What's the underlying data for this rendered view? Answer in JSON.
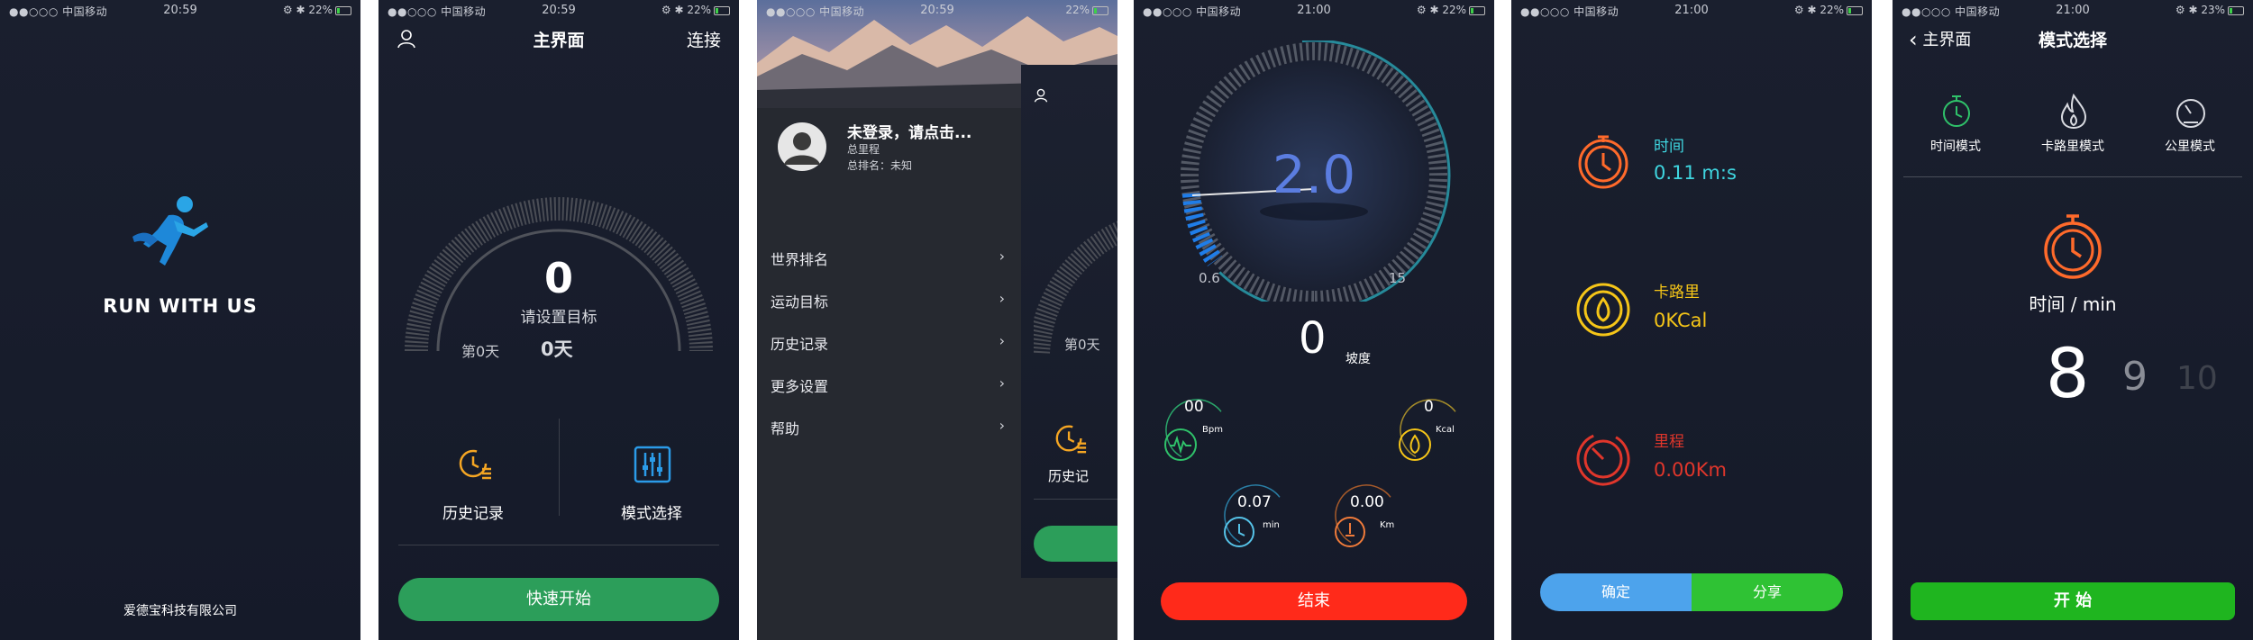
{
  "statusbar": {
    "carrier": "●●○○○ 中国移动",
    "s1_time": "20:59",
    "s1_right": "⚙ ✱ 22%",
    "s2_time": "20:59",
    "s2_right": "⚙ ✱ 22%",
    "s3_time": "20:59",
    "s3_right": "22%",
    "s4_time": "21:00",
    "s4_right": "⚙ ✱ 22%",
    "s5_time": "21:00",
    "s5_right": "⚙ ✱ 22%",
    "s6_time": "21:00",
    "s6_right": "⚙ ✱ 23%"
  },
  "splash": {
    "app_name": "RUN WITH US",
    "company": "爱德宝科技有限公司"
  },
  "home": {
    "title": "主界面",
    "connect": "连接",
    "goal_value": "0",
    "goal_hint": "请设置目标",
    "day_label": "第0天",
    "day_value": "0天",
    "history": "历史记录",
    "mode": "模式选择",
    "quick_start": "快速开始"
  },
  "drawer": {
    "login": "未登录，请点击...",
    "total_mileage": "总里程",
    "total_rank": "总排名：未知",
    "items": [
      "世界排名",
      "运动目标",
      "历史记录",
      "更多设置",
      "帮助"
    ],
    "peek_day": "第0天",
    "peek_history": "历史记"
  },
  "dashboard": {
    "speed": "2.0",
    "min_label": "0.6",
    "max_label": "15",
    "incline": "0",
    "incline_label": "坡度",
    "bpm_value": "00",
    "bpm_unit": "Bpm",
    "kcal_value": "0",
    "kcal_unit": "Kcal",
    "time_value": "0.07",
    "time_unit": "min",
    "km_value": "0.00",
    "km_unit": "Km",
    "end": "结束"
  },
  "summary": {
    "time_label": "时间",
    "time_value": "0.11 m:s",
    "cal_label": "卡路里",
    "cal_value": "0KCal",
    "dist_label": "里程",
    "dist_value": "0.00Km",
    "confirm": "确定",
    "share": "分享",
    "colors": {
      "time": "#ff6a2b",
      "time_text": "#3fd6e0",
      "cal": "#f5c518",
      "dist": "#e0362b",
      "confirm": "#4da3ec",
      "share": "#2fc234"
    }
  },
  "modes": {
    "back": "主界面",
    "title": "模式选择",
    "tabs": [
      "时间模式",
      "卡路里模式",
      "公里模式"
    ],
    "selected_label": "时间 / min",
    "picker": [
      "8",
      "9",
      "10"
    ],
    "start": "开 始"
  }
}
